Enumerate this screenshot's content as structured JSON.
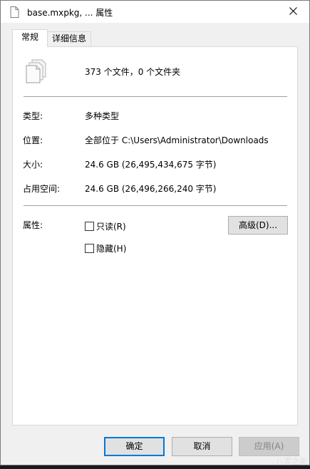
{
  "window": {
    "title": "base.mxpkg, ... 属性",
    "close_icon": "close-icon"
  },
  "tabs": [
    {
      "label": "常规",
      "active": true
    },
    {
      "label": "详细信息",
      "active": false
    }
  ],
  "general": {
    "icon": "multiple-files-icon",
    "summary": "373 个文件，0 个文件夹",
    "type_label": "类型:",
    "type_value": "多种类型",
    "location_label": "位置:",
    "location_value": "全部位于 C:\\Users\\Administrator\\Downloads",
    "size_label": "大小:",
    "size_value": "24.6 GB (26,495,434,675 字节)",
    "disk_size_label": "占用空间:",
    "disk_size_value": "24.6 GB (26,496,266,240 字节)",
    "attributes_label": "属性:",
    "readonly_label": "只读(R)",
    "readonly_checked": false,
    "hidden_label": "隐藏(H)",
    "hidden_checked": false,
    "advanced_button": "高级(D)..."
  },
  "buttons": {
    "ok": "确定",
    "cancel": "取消",
    "apply": "应用(A)"
  },
  "watermark": "八零之家",
  "colors": {
    "accent": "#0078d7",
    "dialog_bg": "#f0f0f0",
    "panel_bg": "#ffffff"
  }
}
